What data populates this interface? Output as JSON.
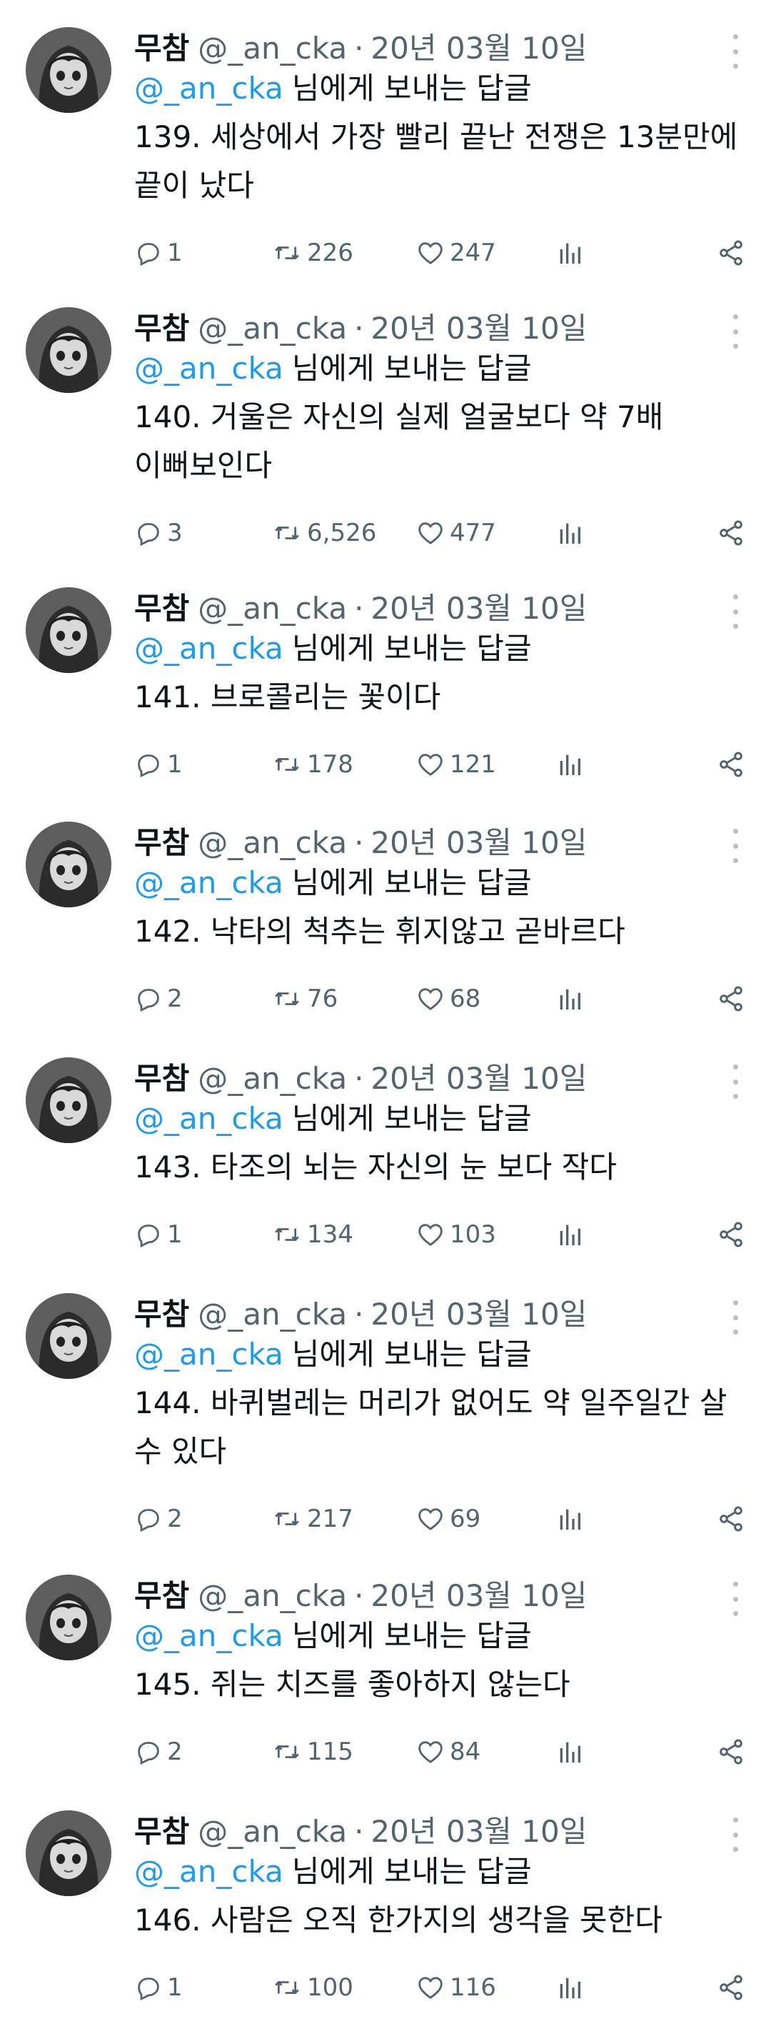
{
  "author": {
    "name": "무참",
    "handle": "@_an_cka",
    "separator": "·",
    "date": "20년 03월 10일"
  },
  "reply_prefix": {
    "mention": "@_an_cka",
    "suffix": "님에게 보내는 답글"
  },
  "colors": {
    "mention": "#1d9bf0",
    "secondary_text": "#536471",
    "primary_text": "#0f1419"
  },
  "icons": {
    "reply": "reply-icon",
    "retweet": "retweet-icon",
    "like": "heart-icon",
    "views": "views-icon",
    "share": "share-icon",
    "more": "more-icon"
  },
  "tweets": [
    {
      "text": "139. 세상에서 가장 빨리 끝난 전쟁은 13분만에 끝이 났다",
      "replies": "1",
      "retweets": "226",
      "likes": "247"
    },
    {
      "text": "140. 거울은 자신의 실제 얼굴보다 약 7배 이뻐보인다",
      "replies": "3",
      "retweets": "6,526",
      "likes": "477"
    },
    {
      "text": "141. 브로콜리는 꽃이다",
      "replies": "1",
      "retweets": "178",
      "likes": "121"
    },
    {
      "text": "142. 낙타의 척추는 휘지않고 곧바르다",
      "replies": "2",
      "retweets": "76",
      "likes": "68"
    },
    {
      "text": "143. 타조의 뇌는 자신의 눈 보다 작다",
      "replies": "1",
      "retweets": "134",
      "likes": "103"
    },
    {
      "text": "144. 바퀴벌레는 머리가 없어도 약 일주일간 살 수 있다",
      "replies": "2",
      "retweets": "217",
      "likes": "69"
    },
    {
      "text": "145. 쥐는 치즈를 좋아하지 않는다",
      "replies": "2",
      "retweets": "115",
      "likes": "84"
    },
    {
      "text": "146. 사람은 오직 한가지의 생각을 못한다",
      "replies": "1",
      "retweets": "100",
      "likes": "116"
    }
  ]
}
